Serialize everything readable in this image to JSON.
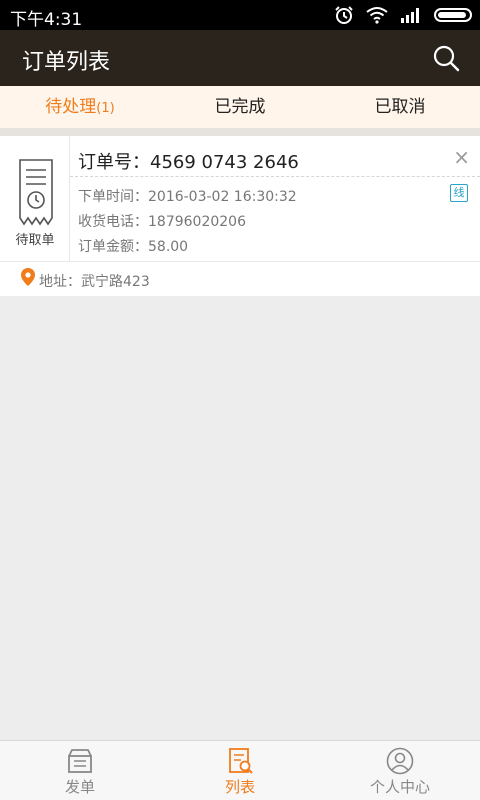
{
  "status_bar": {
    "time": "下午4:31"
  },
  "app_bar": {
    "title": "订单列表"
  },
  "tabs": [
    {
      "label": "待处理",
      "count": "(1)"
    },
    {
      "label": "已完成"
    },
    {
      "label": "已取消"
    }
  ],
  "order": {
    "status_label": "待取单",
    "number": "订单号：4569 0743 2646",
    "time": "下单时间：2016-03-02 16:30:32",
    "phone": "收货电话：18796020206",
    "amount": "订单金额：58.00",
    "badge": "线",
    "address": "地址：武宁路423",
    "close": "×"
  },
  "bottom_nav": [
    {
      "label": "发单"
    },
    {
      "label": "列表"
    },
    {
      "label": "个人中心"
    }
  ],
  "colors": {
    "accent": "#f07c1c",
    "app_bar": "#2a241d",
    "badge": "#2aa5c9"
  }
}
